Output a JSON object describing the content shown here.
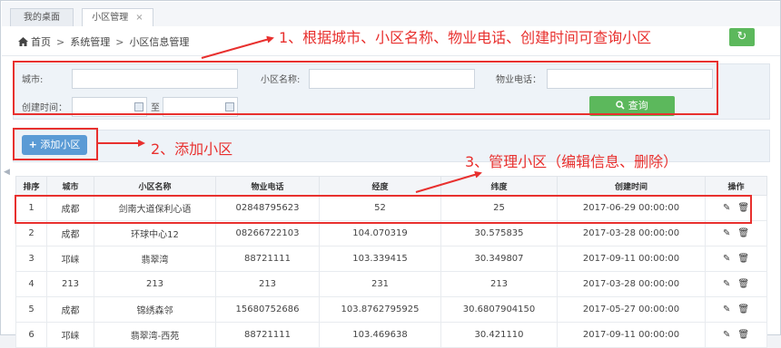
{
  "tabs": [
    {
      "label": "我的桌面"
    },
    {
      "label": "小区管理",
      "close": "×"
    }
  ],
  "breadcrumb": {
    "items": [
      "首页",
      "系统管理",
      "小区信息管理"
    ],
    "separator": ">"
  },
  "refresh_icon": "↻",
  "search": {
    "city_label": "城市:",
    "name_label": "小区名称:",
    "phone_label": "物业电话：",
    "created_label": "创建时间：",
    "to_label": "至",
    "button_label": "查询",
    "city_value": "",
    "name_value": "",
    "phone_value": "",
    "date_from": "",
    "date_to": ""
  },
  "add_button": {
    "icon": "+",
    "label": "添加小区"
  },
  "annotations": {
    "a1": "1、根据城市、小区名称、物业电话、创建时间可查询小区",
    "a2": "2、添加小区",
    "a3": "3、管理小区（编辑信息、删除）"
  },
  "table": {
    "headers": [
      "排序",
      "城市",
      "小区名称",
      "物业电话",
      "经度",
      "纬度",
      "创建时间",
      "操作"
    ],
    "rows": [
      {
        "sort": "1",
        "city": "成都",
        "name": "剑南大道保利心语",
        "phone": "02848795623",
        "lng": "52",
        "lat": "25",
        "created": "2017-06-29 00:00:00"
      },
      {
        "sort": "2",
        "city": "成都",
        "name": "环球中心12",
        "phone": "08266722103",
        "lng": "104.070319",
        "lat": "30.575835",
        "created": "2017-03-28 00:00:00"
      },
      {
        "sort": "3",
        "city": "邛崃",
        "name": "翡翠湾",
        "phone": "88721111",
        "lng": "103.339415",
        "lat": "30.349807",
        "created": "2017-09-11 00:00:00"
      },
      {
        "sort": "4",
        "city": "213",
        "name": "213",
        "phone": "213",
        "lng": "231",
        "lat": "213",
        "created": "2017-03-28 00:00:00"
      },
      {
        "sort": "5",
        "city": "成都",
        "name": "锦绣森邻",
        "phone": "15680752686",
        "lng": "103.8762795925",
        "lat": "30.6807904150",
        "created": "2017-05-27 00:00:00"
      },
      {
        "sort": "6",
        "city": "邛崃",
        "name": "翡翠湾-西苑",
        "phone": "88721111",
        "lng": "103.469638",
        "lat": "30.421110",
        "created": "2017-09-11 00:00:00"
      }
    ]
  },
  "colors": {
    "annotation": "#e8302e",
    "green": "#5cb85c",
    "blue": "#5b9bd5"
  }
}
